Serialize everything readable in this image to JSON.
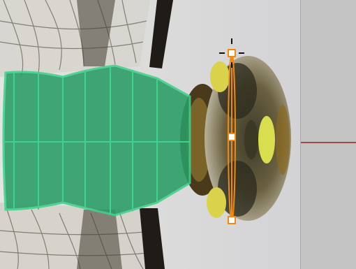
{
  "colors": {
    "background": "#d9d9db",
    "panel": "#c3c3c4",
    "panel_line": "#9e4b48",
    "mask_fill": "#2a9d66",
    "mask_stroke": "#3fd28a",
    "handle": "#f08a12",
    "handle_fill": "#ffffff"
  },
  "icons": {
    "crosshair": "crosshair-icon",
    "handles": "control-point-icon"
  }
}
